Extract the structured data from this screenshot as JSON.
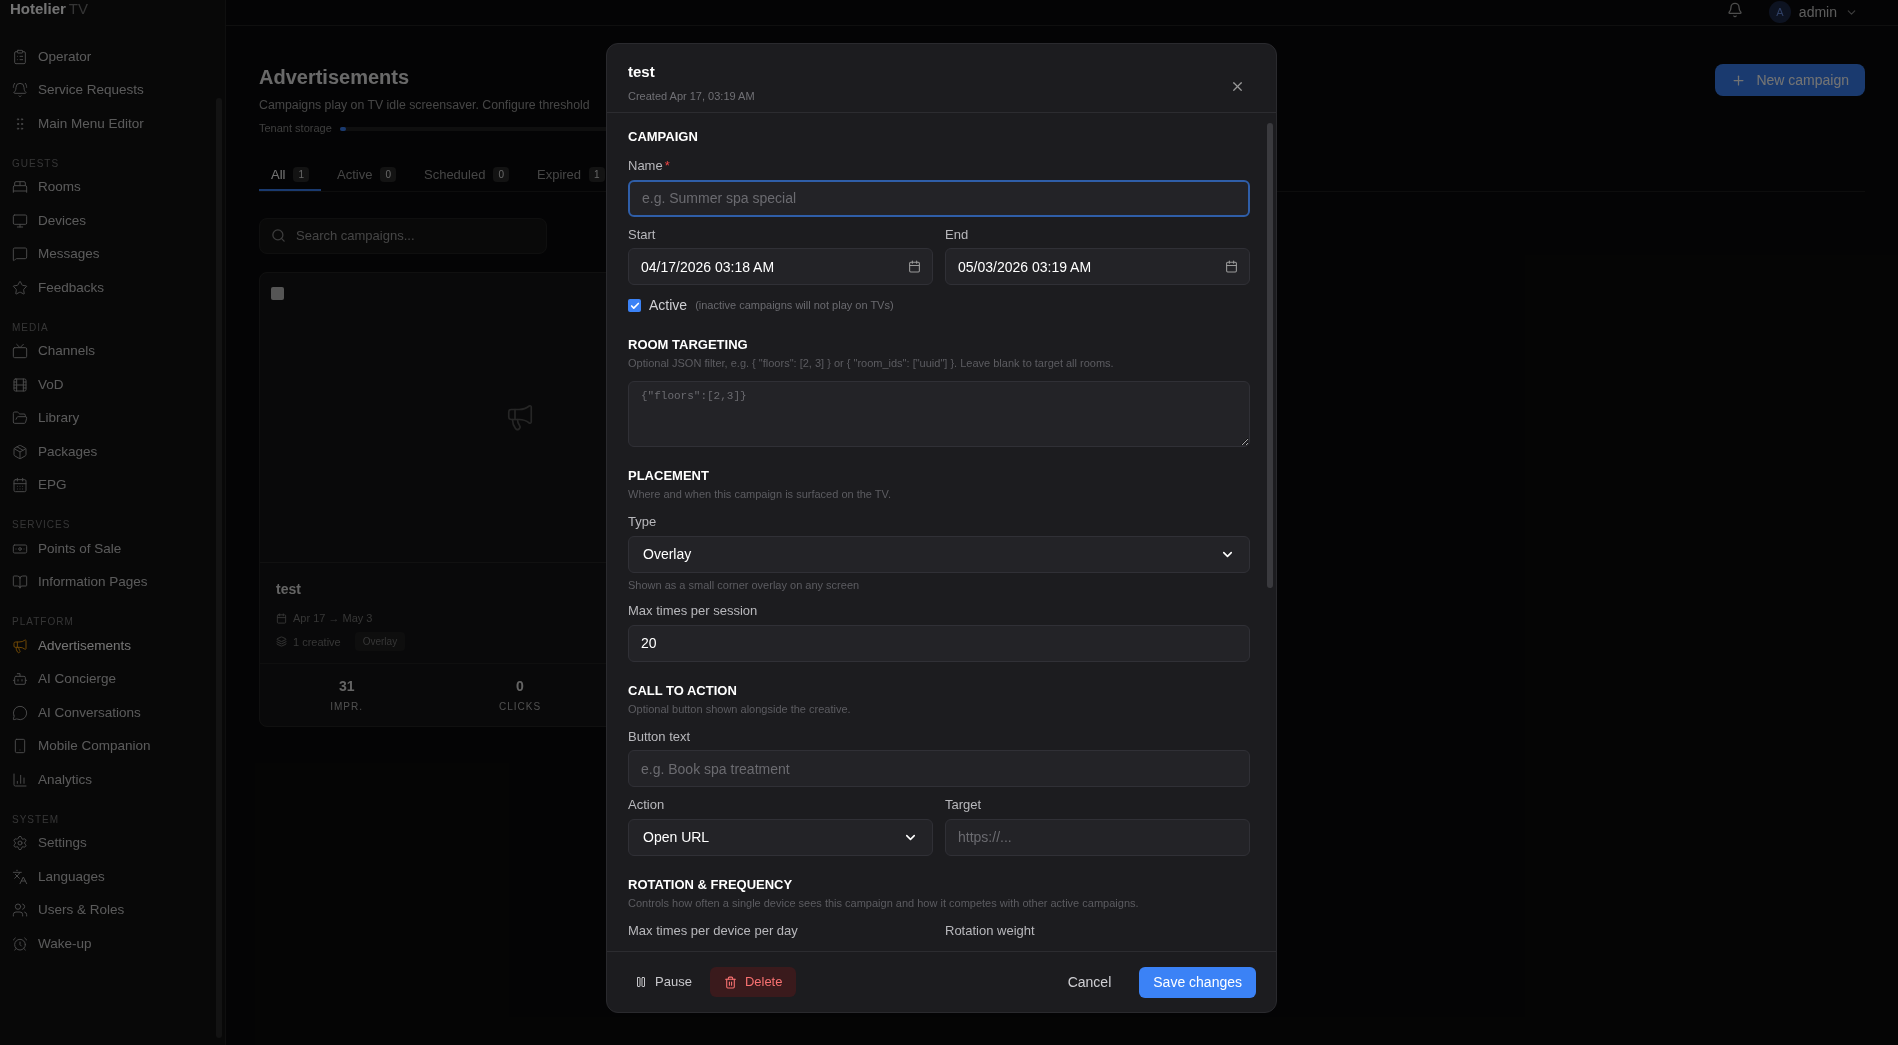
{
  "app": {
    "logo": "Hotelier",
    "logo_suffix": "TV"
  },
  "topbar": {
    "user_initial": "A",
    "user_name": "admin"
  },
  "sidebar": {
    "top_items": [
      {
        "label": "Operator",
        "selected": false
      },
      {
        "label": "Service Requests",
        "selected": false
      },
      {
        "label": "Main Menu Editor",
        "selected": false
      }
    ],
    "groups": [
      {
        "title": "GUESTS",
        "items": [
          {
            "label": "Rooms",
            "selected": false
          },
          {
            "label": "Devices",
            "selected": false
          },
          {
            "label": "Messages",
            "selected": false
          },
          {
            "label": "Feedbacks",
            "selected": false
          }
        ]
      },
      {
        "title": "MEDIA",
        "items": [
          {
            "label": "Channels",
            "selected": false
          },
          {
            "label": "VoD",
            "selected": false
          },
          {
            "label": "Library",
            "selected": false
          },
          {
            "label": "Packages",
            "selected": false
          },
          {
            "label": "EPG",
            "selected": false
          }
        ]
      },
      {
        "title": "SERVICES",
        "items": [
          {
            "label": "Points of Sale",
            "selected": false
          },
          {
            "label": "Information Pages",
            "selected": false
          }
        ]
      },
      {
        "title": "PLATFORM",
        "items": [
          {
            "label": "Advertisements",
            "selected": true
          },
          {
            "label": "AI Concierge",
            "selected": false
          },
          {
            "label": "AI Conversations",
            "selected": false
          },
          {
            "label": "Mobile Companion",
            "selected": false
          },
          {
            "label": "Analytics",
            "selected": false
          }
        ]
      },
      {
        "title": "SYSTEM",
        "items": [
          {
            "label": "Settings",
            "selected": false
          },
          {
            "label": "Languages",
            "selected": false
          },
          {
            "label": "Users & Roles",
            "selected": false
          },
          {
            "label": "Wake-up",
            "selected": false
          }
        ]
      }
    ]
  },
  "page": {
    "title": "Advertisements",
    "subtitle": "Campaigns play on TV idle screensaver. Configure threshold",
    "storage": {
      "label": "Tenant storage",
      "level": 0.02
    },
    "new_button": "New campaign",
    "tabs": [
      {
        "label": "All",
        "count": "1",
        "selected": true
      },
      {
        "label": "Active",
        "count": "0",
        "selected": false
      },
      {
        "label": "Scheduled",
        "count": "0",
        "selected": false
      },
      {
        "label": "Expired",
        "count": "1",
        "selected": false
      }
    ],
    "search": {
      "placeholder": "Search campaigns..."
    },
    "cards": [
      {
        "title": "test",
        "checked": false,
        "dates": "Apr 17 → May 3",
        "creatives": "1 creative",
        "badge": "Overlay",
        "stats": [
          {
            "value": "31",
            "label": "IMPR."
          },
          {
            "value": "0",
            "label": "CLICKS"
          }
        ]
      }
    ]
  },
  "modal": {
    "title": "test",
    "subtitle": "Created Apr 17, 03:19 AM",
    "sections": [
      {
        "title": "CAMPAIGN",
        "rows": [
          [
            {
              "kind": "text",
              "label": "Name",
              "required_mark": "*",
              "focused": true,
              "placeholder": "e.g. Summer spa special"
            }
          ],
          [
            {
              "kind": "datetime",
              "label": "Start",
              "value": "04/17/2026 03:18 AM"
            },
            {
              "kind": "datetime",
              "label": "End",
              "value": "05/03/2026 03:19 AM"
            }
          ],
          [
            {
              "kind": "checkbox",
              "label": "Active",
              "note": "(inactive campaigns will not play on TVs)",
              "checked": true
            }
          ]
        ]
      },
      {
        "title": "ROOM TARGETING",
        "description": "Optional JSON filter, e.g. { \"floors\": [2, 3] } or { \"room_ids\": [\"uuid\"] }. Leave blank to target all rooms.",
        "rows": [
          [
            {
              "kind": "textarea",
              "placeholder": "{\"floors\":[2,3]}"
            }
          ]
        ]
      },
      {
        "title": "PLACEMENT",
        "description": "Where and when this campaign is surfaced on the TV.",
        "rows": [
          [
            {
              "kind": "select",
              "label": "Type",
              "value": "Overlay",
              "hint": "Shown as a small corner overlay on any screen"
            }
          ],
          [
            {
              "kind": "text",
              "label": "Max times per session",
              "value": "20"
            }
          ]
        ]
      },
      {
        "title": "CALL TO ACTION",
        "description": "Optional button shown alongside the creative.",
        "rows": [
          [
            {
              "kind": "text",
              "label": "Button text",
              "placeholder": "e.g. Book spa treatment"
            }
          ],
          [
            {
              "kind": "select",
              "label": "Action",
              "value": "Open URL"
            },
            {
              "kind": "text",
              "label": "Target",
              "placeholder": "https://..."
            }
          ]
        ]
      },
      {
        "title": "ROTATION & FREQUENCY",
        "description": "Controls how often a single device sees this campaign and how it competes with other active campaigns.",
        "rows": [
          [
            {
              "kind": "label",
              "label": "Max times per device per day"
            },
            {
              "kind": "label",
              "label": "Rotation weight"
            }
          ]
        ]
      }
    ],
    "footer": {
      "pause": "Pause",
      "delete": "Delete",
      "cancel": "Cancel",
      "save": "Save changes"
    }
  }
}
